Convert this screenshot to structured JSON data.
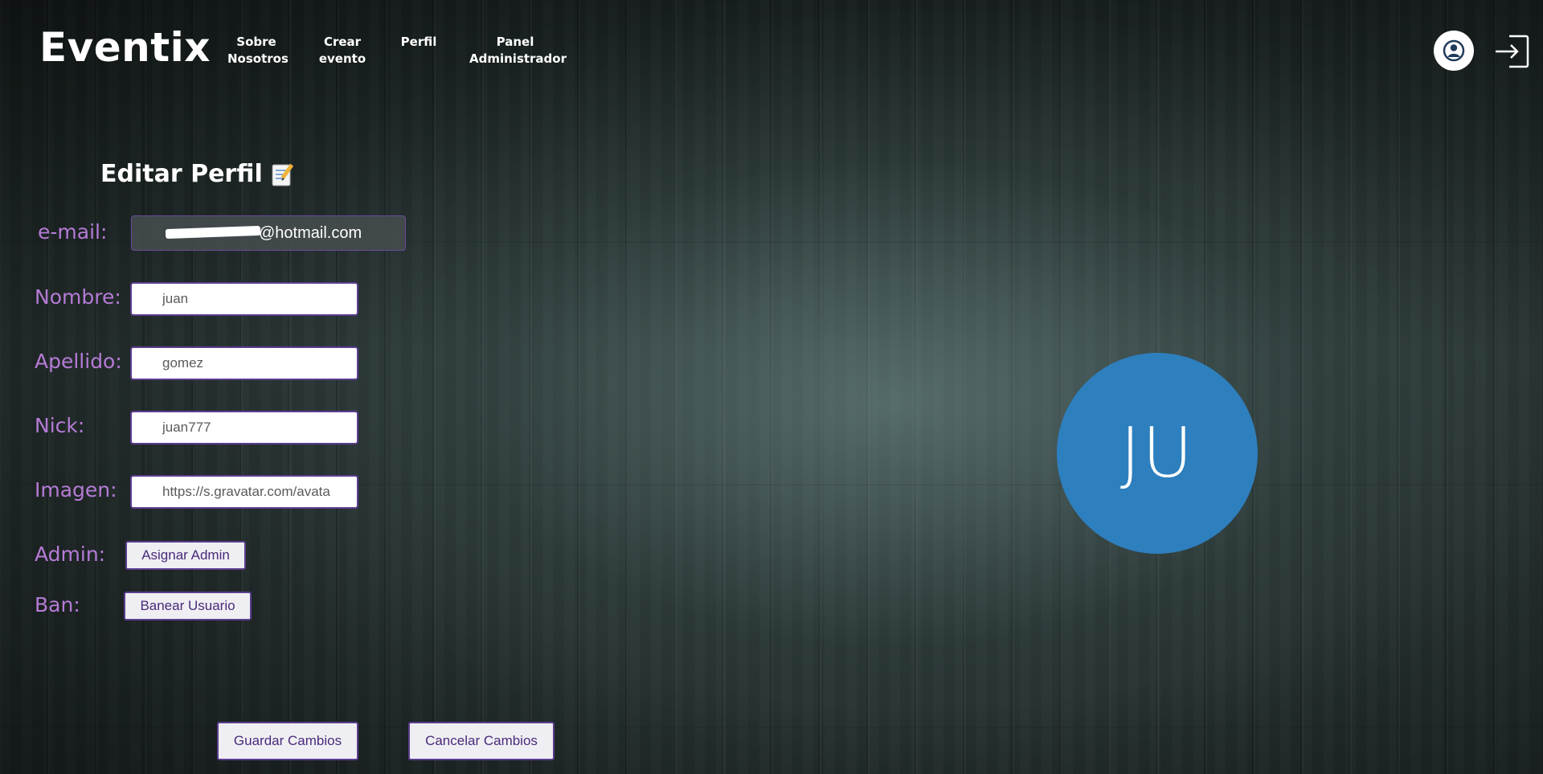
{
  "header": {
    "logo": "Eventix",
    "nav": [
      {
        "line1": "Sobre",
        "line2": "Nosotros"
      },
      {
        "line1": "Crear",
        "line2": "evento"
      },
      {
        "line1": "Perfil",
        "line2": ""
      },
      {
        "line1": "Panel",
        "line2": "Administrador"
      }
    ],
    "icons": {
      "user": "user-circle-icon",
      "logout": "logout-icon"
    }
  },
  "form": {
    "title": "Editar Perfil",
    "title_icon": "memo-icon",
    "labels": {
      "email": "e-mail:",
      "nombre": "Nombre:",
      "apellido": "Apellido:",
      "nick": "Nick:",
      "imagen": "Imagen:",
      "admin": "Admin:",
      "ban": "Ban:"
    },
    "email_value": "@hotmail.com",
    "fields": {
      "nombre": "juan",
      "apellido": "gomez",
      "nick": "juan777",
      "imagen": "https://s.gravatar.com/avata"
    },
    "buttons": {
      "asignar_admin": "Asignar Admin",
      "banear_usuario": "Banear Usuario",
      "guardar": "Guardar Cambios",
      "cancelar": "Cancelar Cambios"
    }
  },
  "avatar": {
    "initials": "JU",
    "color": "#2e7fbe"
  },
  "colors": {
    "label": "#b57bd6",
    "button_border": "#5b3d8f",
    "button_text": "#4a2a7a"
  }
}
